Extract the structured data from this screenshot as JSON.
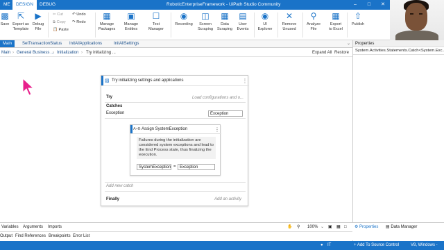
{
  "titlebar": {
    "tabs": [
      "ME",
      "DESIGN",
      "DEBUG"
    ],
    "title": "RoboticEnterpriseFramework - UiPath Studio Community"
  },
  "ribbon": {
    "save": "Save",
    "export_template": "Export as\nTemplate",
    "debug_file": "Debug\nFile",
    "cut": "Cut",
    "copy": "Copy",
    "paste": "Paste",
    "undo": "Undo",
    "redo": "Redo",
    "manage_packages": "Manage\nPackages",
    "manage_entities": "Manage\nEntities",
    "test_manager": "Test\nManager",
    "recording": "Recording",
    "screen_scraping": "Screen\nScraping",
    "data_scraping": "Data\nScraping",
    "user_events": "User\nEvents",
    "ui_explorer": "UI\nExplorer",
    "remove_unused": "Remove\nUnused",
    "analyze_file": "Analyze\nFile",
    "export_excel": "Export\nto Excel",
    "publish": "Publish"
  },
  "doc_tabs": [
    "Main",
    "SetTransactionStatus",
    "InitAllApplications",
    "InitAllSettings"
  ],
  "breadcrumb": {
    "items": [
      "Main",
      "General Business ...",
      "Initialization",
      "Try initializing ..."
    ],
    "expand_all": "Expand All",
    "restore": "Restore"
  },
  "properties": {
    "header": "Properties",
    "selected": "System.Activities.Statements.Catch<System.Exc..."
  },
  "workflow": {
    "try_catch_title": "Try initializing settings and applications",
    "try_label": "Try",
    "try_placeholder": "Load configurations and o...",
    "catches_label": "Catches",
    "exception_label": "Exception",
    "exception_value": "Exception",
    "assign_title": "Assign SystemException",
    "annotation": "Failures during the initialization are considered system exceptions and lead to the End Process state, thus finalizing the execution.",
    "assign_to": "SystemException",
    "assign_eq": "=",
    "assign_value": "Exception",
    "add_catch": "Add new catch",
    "finally_label": "Finally",
    "add_activity": "Add an activity"
  },
  "bottom": {
    "panels": [
      "Variables",
      "Arguments",
      "Imports"
    ],
    "zoom": "100%",
    "panels2": [
      "Output",
      "Find References",
      "Breakpoints",
      "Error List"
    ],
    "props_tab": "Properties",
    "data_manager_tab": "Data Manager"
  },
  "status": {
    "lang": "IT",
    "source_control": "+ Add To Source Control",
    "version": "V8, Windows - Le..."
  }
}
